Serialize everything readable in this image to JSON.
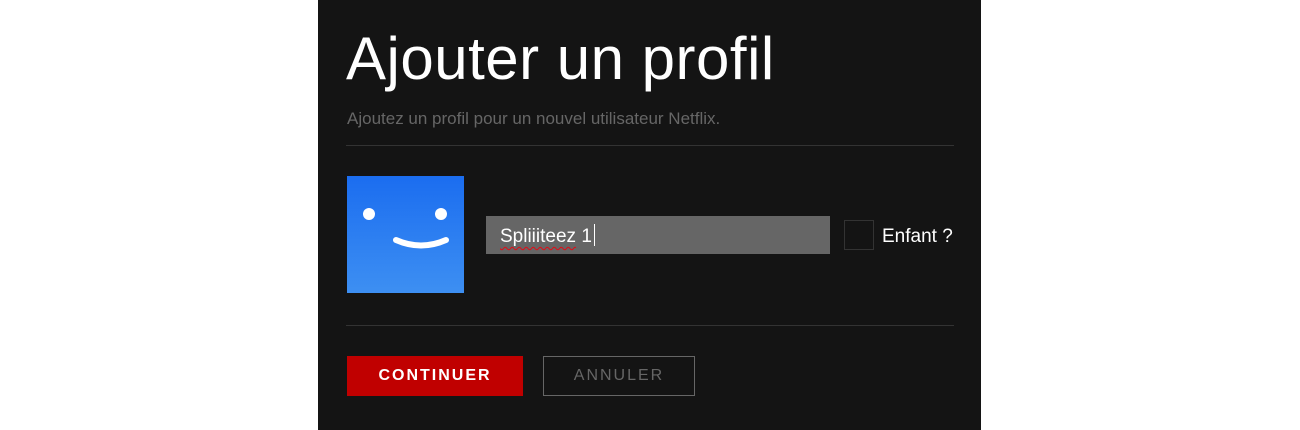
{
  "title": "Ajouter un profil",
  "subtitle": "Ajoutez un profil pour un nouvel utilisateur Netflix.",
  "profile": {
    "avatar_icon": "smiley-face-icon",
    "avatar_color": "#1b6df0",
    "name_value_misspelled": "Spliiiteez",
    "name_value_rest": " 1",
    "name_full": "Spliiiteez 1"
  },
  "kid": {
    "label": "Enfant ?",
    "checked": false
  },
  "actions": {
    "continue_label": "CONTINUER",
    "cancel_label": "ANNULER",
    "accent_color": "#c00000"
  }
}
